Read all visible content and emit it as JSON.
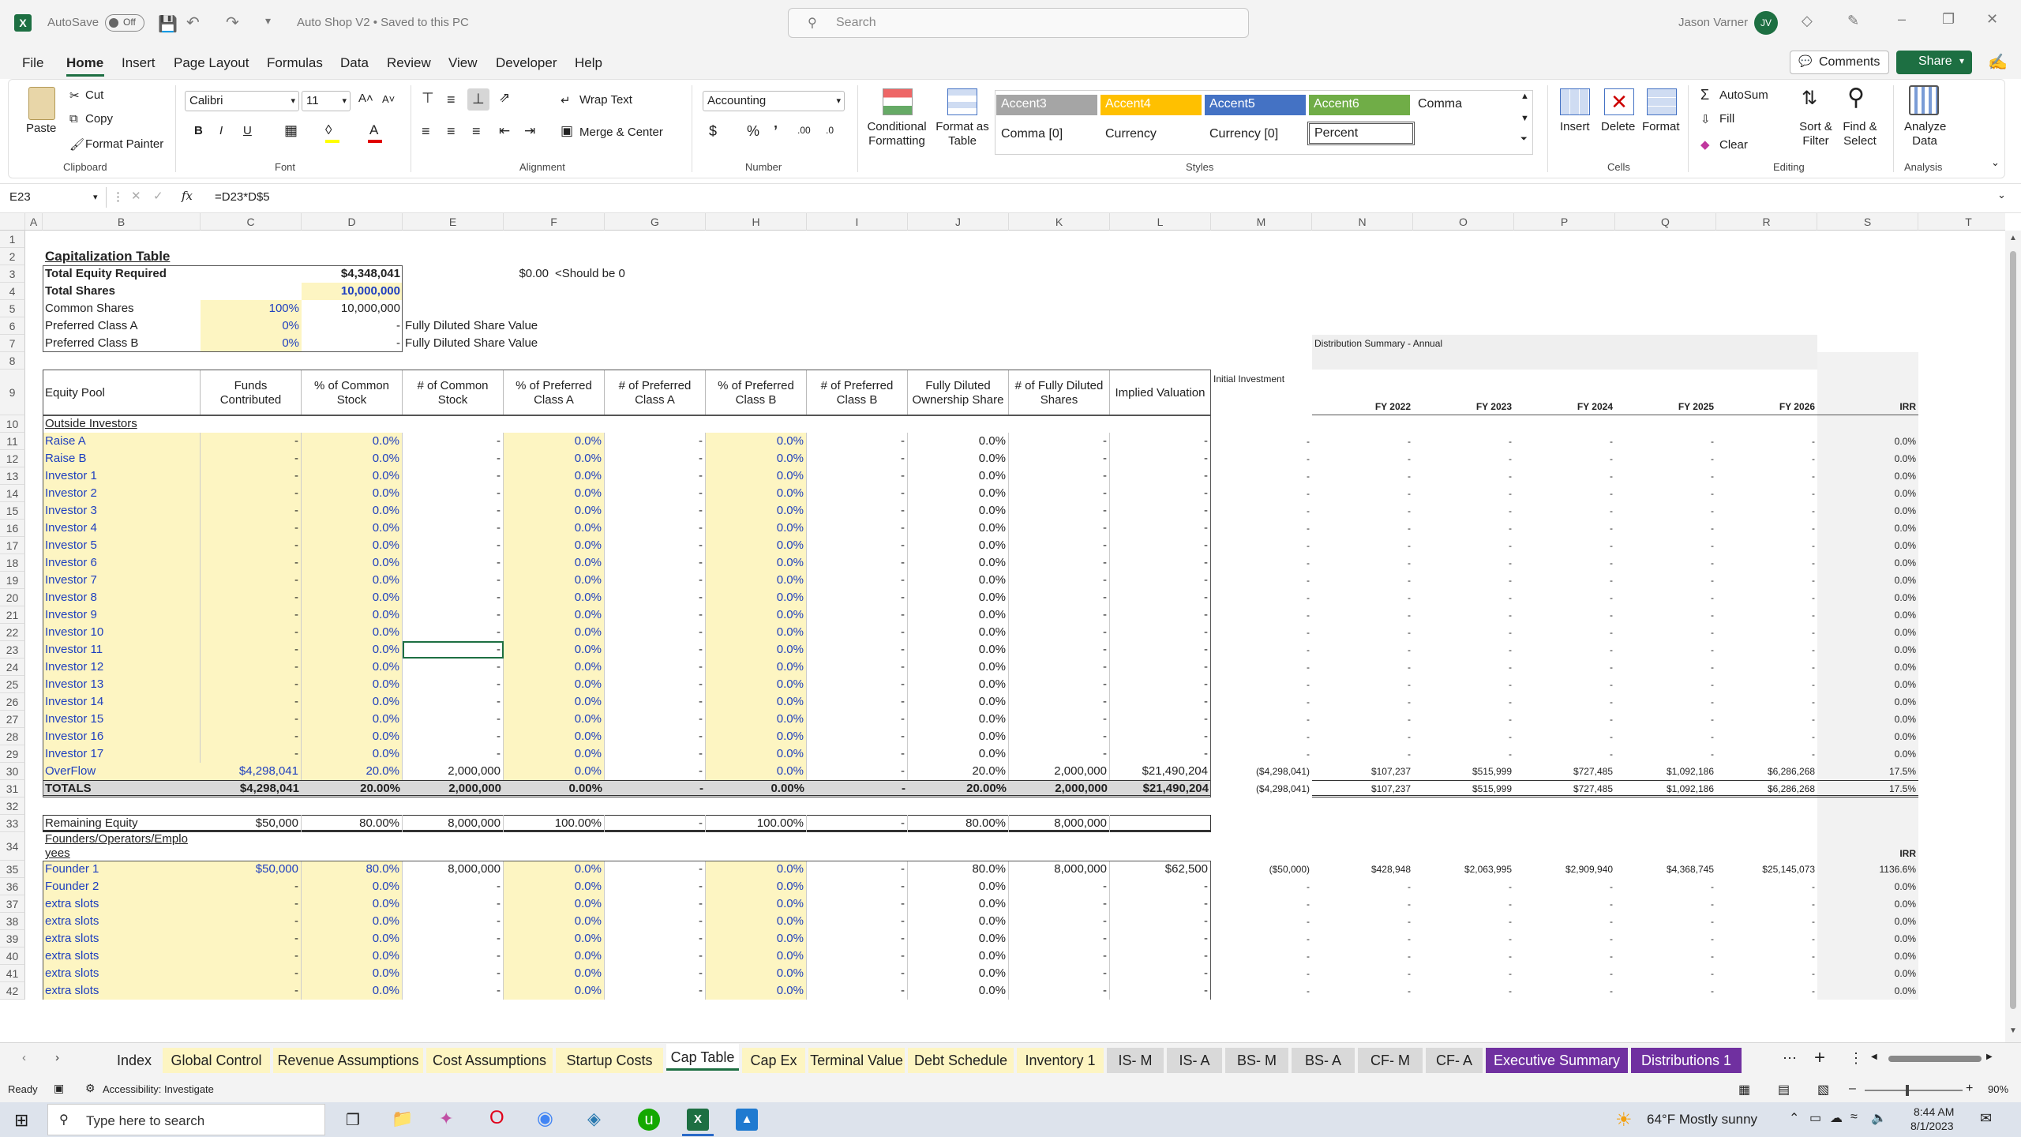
{
  "titlebar": {
    "autosave_label": "AutoSave",
    "autosave_state": "Off",
    "doc_title": "Auto Shop V2 • Saved to this PC",
    "search_placeholder": "Search",
    "user_name": "Jason Varner",
    "user_initials": "JV"
  },
  "menu": [
    "File",
    "Home",
    "Insert",
    "Page Layout",
    "Formulas",
    "Data",
    "Review",
    "View",
    "Developer",
    "Help"
  ],
  "menu_right": {
    "comments": "Comments",
    "share": "Share"
  },
  "ribbon": {
    "clipboard": {
      "paste": "Paste",
      "cut": "Cut",
      "copy": "Copy",
      "format_painter": "Format Painter",
      "group": "Clipboard"
    },
    "font": {
      "name": "Calibri",
      "size": "11",
      "group": "Font"
    },
    "alignment": {
      "wrap": "Wrap Text",
      "merge": "Merge & Center",
      "group": "Alignment"
    },
    "number": {
      "format": "Accounting",
      "group": "Number"
    },
    "styles": {
      "conditional": "Conditional Formatting",
      "format_table": "Format as Table",
      "cells_row1": [
        "Accent3",
        "Accent4",
        "Accent5",
        "Accent6",
        "Comma"
      ],
      "cells_row2": [
        "Comma [0]",
        "Currency",
        "Currency [0]",
        "Percent"
      ],
      "group": "Styles"
    },
    "cells": {
      "insert": "Insert",
      "delete": "Delete",
      "format": "Format",
      "group": "Cells"
    },
    "editing": {
      "autosum": "AutoSum",
      "fill": "Fill",
      "clear": "Clear",
      "sort": "Sort & Filter",
      "find": "Find & Select",
      "group": "Editing"
    },
    "analysis": {
      "analyze": "Analyze Data",
      "group": "Analysis"
    },
    "colors": {
      "accent3": "#a5a5a5",
      "accent4": "#ffc000",
      "accent5": "#4472c4",
      "accent6": "#70ad47"
    }
  },
  "formula_bar": {
    "name_box": "E23",
    "fx": "fx",
    "formula": "=D23*D$5"
  },
  "columns": [
    "A",
    "B",
    "C",
    "D",
    "E",
    "F",
    "G",
    "H",
    "I",
    "J",
    "K",
    "L",
    "M",
    "N",
    "O",
    "P",
    "Q",
    "R",
    "S",
    "T"
  ],
  "sheet": {
    "title": "Capitalization Table",
    "total_equity_label": "Total Equity Required",
    "total_equity_value": "$4,348,041",
    "should_be_zero": "$0.00",
    "should_be_zero_note": "<Should be 0",
    "total_shares_label": "Total Shares",
    "total_shares_value": "10,000,000",
    "common_label": "Common Shares",
    "common_pct": "100%",
    "common_value": "10,000,000",
    "prefA_label": "Preferred Class A",
    "prefA_pct": "0%",
    "prefA_value": "-",
    "prefA_note": "Fully Diluted Share Value",
    "prefB_label": "Preferred Class B",
    "prefB_pct": "0%",
    "prefB_value": "-",
    "prefB_note": "Fully Diluted Share Value",
    "dist_title": "Distribution Summary - Annual",
    "headers": [
      "Equity Pool",
      "Funds Contributed",
      "% of Common Stock",
      "# of Common Stock",
      "% of Preferred Class A",
      "# of Preferred Class A",
      "% of Preferred Class B",
      "# of Preferred Class B",
      "Fully Diluted Ownership Share",
      "# of Fully Diluted Shares",
      "Implied Valuation"
    ],
    "dist_headers": [
      "Initial Investment",
      "FY 2022",
      "FY 2023",
      "FY 2024",
      "FY 2025",
      "FY 2026",
      "IRR"
    ],
    "outside_label": "Outside Investors",
    "investor_rows": [
      {
        "name": "Raise A",
        "irr": "0.0%"
      },
      {
        "name": "Raise B",
        "irr": "0.0%"
      },
      {
        "name": "Investor 1",
        "irr": "0.0%"
      },
      {
        "name": "Investor 2",
        "irr": "0.0%"
      },
      {
        "name": "Investor 3",
        "irr": "0.0%"
      },
      {
        "name": "Investor 4",
        "irr": "0.0%"
      },
      {
        "name": "Investor 5",
        "irr": "0.0%"
      },
      {
        "name": "Investor 6",
        "irr": "0.0%"
      },
      {
        "name": "Investor 7",
        "irr": "0.0%"
      },
      {
        "name": "Investor 8",
        "irr": "0.0%"
      },
      {
        "name": "Investor 9",
        "irr": "0.0%"
      },
      {
        "name": "Investor 10",
        "irr": "0.0%"
      },
      {
        "name": "Investor 11",
        "irr": "0.0%"
      },
      {
        "name": "Investor 12",
        "irr": "0.0%"
      },
      {
        "name": "Investor 13",
        "irr": "0.0%"
      },
      {
        "name": "Investor 14",
        "irr": "0.0%"
      },
      {
        "name": "Investor 15",
        "irr": "0.0%"
      },
      {
        "name": "Investor 16",
        "irr": "0.0%"
      },
      {
        "name": "Investor 17",
        "irr": "0.0%"
      }
    ],
    "zero_row": {
      "funds": "-",
      "pct_common": "0.0%",
      "num_common": "-",
      "pct_a": "0.0%",
      "num_a": "-",
      "pct_b": "0.0%",
      "num_b": "-",
      "fd_share": "0.0%",
      "fd_shares": "-",
      "valuation": "-",
      "dist": "-"
    },
    "overflow": {
      "name": "OverFlow",
      "funds": "$4,298,041",
      "pct_common": "20.0%",
      "num_common": "2,000,000",
      "pct_a": "0.0%",
      "num_a": "-",
      "pct_b": "0.0%",
      "num_b": "-",
      "fd_share": "20.0%",
      "fd_shares": "2,000,000",
      "valuation": "$21,490,204",
      "init": "($4,298,041)",
      "fy": [
        "$107,237",
        "$515,999",
        "$727,485",
        "$1,092,186",
        "$6,286,268"
      ],
      "irr": "17.5%"
    },
    "totals": {
      "name": "TOTALS",
      "funds": "$4,298,041",
      "pct_common": "20.00%",
      "num_common": "2,000,000",
      "pct_a": "0.00%",
      "num_a": "-",
      "pct_b": "0.00%",
      "num_b": "-",
      "fd_share": "20.00%",
      "fd_shares": "2,000,000",
      "valuation": "$21,490,204",
      "init": "($4,298,041)",
      "fy": [
        "$107,237",
        "$515,999",
        "$727,485",
        "$1,092,186",
        "$6,286,268"
      ],
      "irr": "17.5%"
    },
    "remaining": {
      "name": "Remaining Equity",
      "funds": "$50,000",
      "pct_common": "80.00%",
      "num_common": "8,000,000",
      "pct_a": "100.00%",
      "num_a": "-",
      "pct_b": "100.00%",
      "num_b": "-",
      "fd_share": "80.00%",
      "fd_shares": "8,000,000"
    },
    "founders_label": "Founders/Operators/Employees",
    "founders_label_1": "Founders/Operators/Emplo",
    "founders_label_2": "yees",
    "irr_label": "IRR",
    "founder1": {
      "name": "Founder 1",
      "funds": "$50,000",
      "pct_common": "80.0%",
      "num_common": "8,000,000",
      "pct_a": "0.0%",
      "num_a": "-",
      "pct_b": "0.0%",
      "num_b": "-",
      "fd_share": "80.0%",
      "fd_shares": "8,000,000",
      "valuation": "$62,500",
      "init": "($50,000)",
      "fy": [
        "$428,948",
        "$2,063,995",
        "$2,909,940",
        "$4,368,745",
        "$25,145,073"
      ],
      "irr": "1136.6%"
    },
    "founder_rows": [
      "Founder 2",
      "extra slots",
      "extra slots",
      "extra slots",
      "extra slots",
      "extra slots",
      "extra slots"
    ],
    "row_numbers": [
      "1",
      "2",
      "3",
      "4",
      "5",
      "6",
      "7",
      "8",
      "9",
      "10",
      "11",
      "12",
      "13",
      "14",
      "15",
      "16",
      "17",
      "18",
      "19",
      "20",
      "21",
      "22",
      "23",
      "24",
      "25",
      "26",
      "27",
      "28",
      "29",
      "30",
      "31",
      "32",
      "33",
      "34",
      "35",
      "36",
      "37",
      "38",
      "39",
      "40",
      "41",
      "42"
    ]
  },
  "tabs": [
    {
      "label": "Index",
      "color": "#f3f3f3"
    },
    {
      "label": "Global Control",
      "color": "#fdf5c2"
    },
    {
      "label": "Revenue Assumptions",
      "color": "#fdf5c2"
    },
    {
      "label": "Cost Assumptions",
      "color": "#fdf5c2"
    },
    {
      "label": "Startup Costs",
      "color": "#fdf5c2"
    },
    {
      "label": "Cap Table",
      "color": "#ffffff"
    },
    {
      "label": "Cap Ex",
      "color": "#fdf5c2"
    },
    {
      "label": "Terminal Value",
      "color": "#fdf5c2"
    },
    {
      "label": "Debt Schedule",
      "color": "#fdf5c2"
    },
    {
      "label": "Inventory 1",
      "color": "#fdf5c2"
    },
    {
      "label": "IS- M",
      "color": "#d9d9d9"
    },
    {
      "label": "IS- A",
      "color": "#d9d9d9"
    },
    {
      "label": "BS- M",
      "color": "#d9d9d9"
    },
    {
      "label": "BS- A",
      "color": "#d9d9d9"
    },
    {
      "label": "CF- M",
      "color": "#d9d9d9"
    },
    {
      "label": "CF- A",
      "color": "#d9d9d9"
    },
    {
      "label": "Executive Summary",
      "color": "#7030a0"
    },
    {
      "label": "Distributions 1",
      "color": "#7030a0"
    }
  ],
  "status": {
    "ready": "Ready",
    "accessibility": "Accessibility: Investigate",
    "zoom": "90%"
  },
  "taskbar": {
    "search": "Type here to search",
    "weather": "64°F  Mostly sunny",
    "time": "8:44 AM",
    "date": "8/1/2023"
  }
}
